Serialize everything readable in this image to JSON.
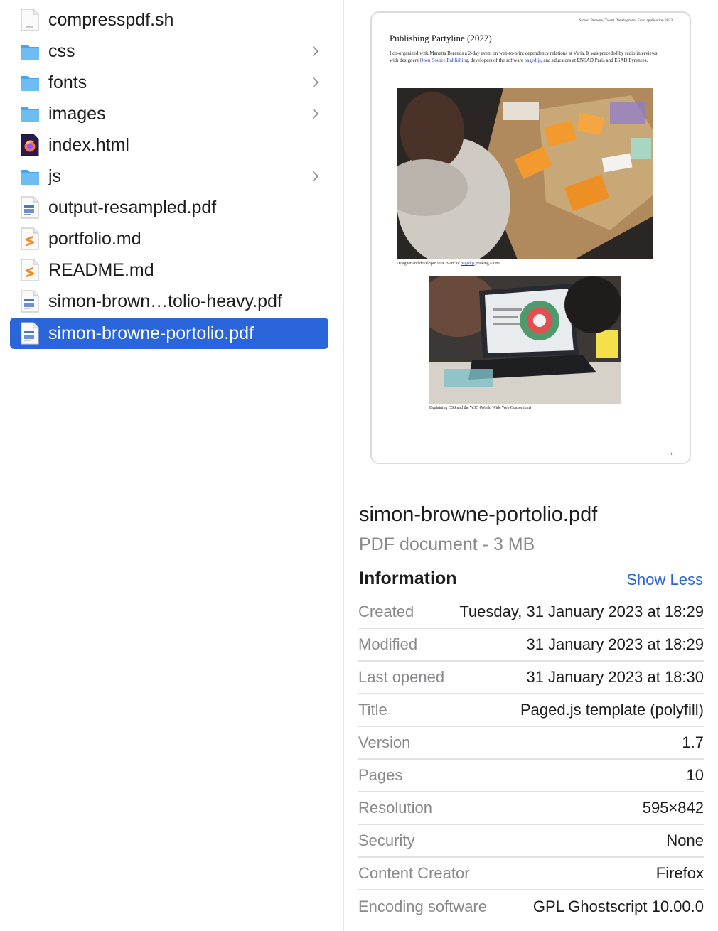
{
  "file_list": [
    {
      "name": "compresspdf.sh",
      "icon": "shell-script-icon",
      "folder": false
    },
    {
      "name": "css",
      "icon": "folder-icon",
      "folder": true
    },
    {
      "name": "fonts",
      "icon": "folder-icon",
      "folder": true
    },
    {
      "name": "images",
      "icon": "folder-icon",
      "folder": true
    },
    {
      "name": "index.html",
      "icon": "firefox-html-icon",
      "folder": false
    },
    {
      "name": "js",
      "icon": "folder-icon",
      "folder": true
    },
    {
      "name": "output-resampled.pdf",
      "icon": "pdf-file-icon",
      "folder": false
    },
    {
      "name": "portfolio.md",
      "icon": "markdown-file-icon",
      "folder": false
    },
    {
      "name": "README.md",
      "icon": "markdown-file-icon",
      "folder": false
    },
    {
      "name": "simon-brown…tolio-heavy.pdf",
      "icon": "pdf-file-icon",
      "folder": false
    },
    {
      "name": "simon-browne-portolio.pdf",
      "icon": "pdf-file-icon",
      "folder": false,
      "selected": true
    }
  ],
  "preview": {
    "header_right": "Simon Browne, Talent Development Fund application 2023",
    "title": "Publishing Partyline (2022)",
    "para_part1": "I co-organized with Manetta Berends a 2-day event on web-to-print dependency relations at Varia. It was preceded by radio interviews with designers ",
    "link1": "Open Source Publishing",
    "para_part2": ", developers of the software ",
    "link2": "paged.js",
    "para_part3": ", and educators at ENSAD Paris and ESAD Pyrenees.",
    "caption1_part1": "Designer and developer Julie Blanc of ",
    "caption1_link": "paged.js",
    "caption1_part2": ", making a zine",
    "caption2": "Explaining CSS and the W3C (World Wide Web Consortium)",
    "page_number": "1"
  },
  "info": {
    "filename": "simon-browne-portolio.pdf",
    "kind": "PDF document - 3 MB",
    "section_title": "Information",
    "toggle_label": "Show Less",
    "rows": [
      {
        "key": "Created",
        "value": "Tuesday, 31 January 2023 at 18:29"
      },
      {
        "key": "Modified",
        "value": "31 January 2023 at 18:29"
      },
      {
        "key": "Last opened",
        "value": "31 January 2023 at 18:30"
      },
      {
        "key": "Title",
        "value": "Paged.js template (polyfill)"
      },
      {
        "key": "Version",
        "value": "1.7"
      },
      {
        "key": "Pages",
        "value": "10"
      },
      {
        "key": "Resolution",
        "value": "595×842"
      },
      {
        "key": "Security",
        "value": "None"
      },
      {
        "key": "Content Creator",
        "value": "Firefox"
      },
      {
        "key": "Encoding software",
        "value": "GPL Ghostscript 10.00.0"
      }
    ]
  },
  "colors": {
    "selection": "#2a65da",
    "folder": "#5ab4f0",
    "link": "#2a65da"
  }
}
